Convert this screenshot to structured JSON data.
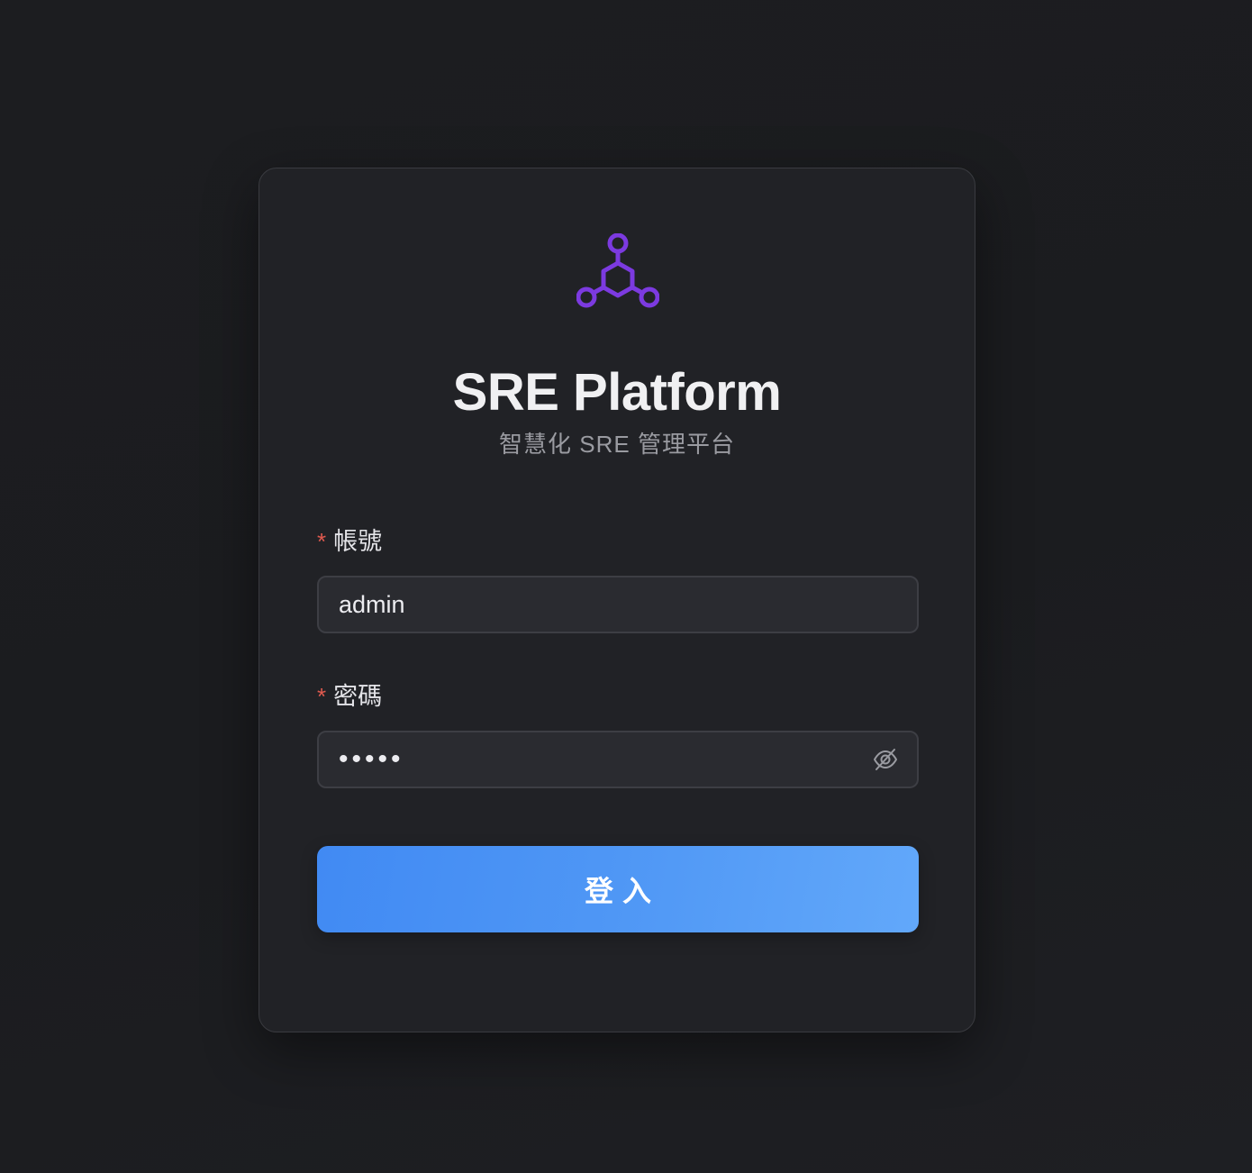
{
  "app": {
    "title": "SRE Platform",
    "subtitle": "智慧化 SRE 管理平台",
    "logo_icon": "network-nodes-icon",
    "logo_color": "#7c3ae0"
  },
  "form": {
    "username": {
      "required_mark": "*",
      "label": "帳號",
      "value": "admin"
    },
    "password": {
      "required_mark": "*",
      "label": "密碼",
      "value": "admin",
      "toggle_icon": "eye-off-icon"
    },
    "submit_label": "登入",
    "submit_color": "#4f97f5"
  }
}
